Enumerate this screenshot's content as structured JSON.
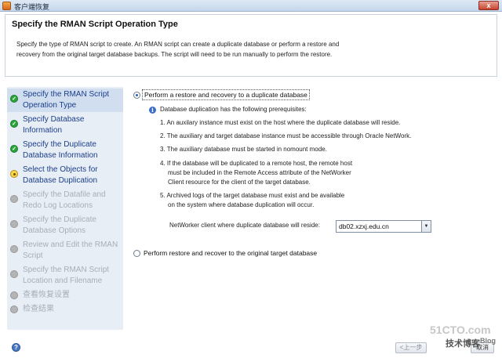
{
  "window": {
    "title": "客户端恢复",
    "close": "x"
  },
  "header": {
    "title": "Specify the RMAN Script Operation Type",
    "desc_line1": "Specify the type of RMAN script to create. An RMAN script can create a duplicate database or perform a restore and",
    "desc_line2": "recovery from the original target database backups.  The script will need to be run manually to perform the restore."
  },
  "steps": [
    {
      "line1": "Specify the RMAN Script",
      "line2": "Operation Type",
      "status": "done"
    },
    {
      "line1": "Specify Database",
      "line2": "Information",
      "status": "done"
    },
    {
      "line1": "Specify the Duplicate",
      "line2": "Database Information",
      "status": "done"
    },
    {
      "line1": "Select the Objects for",
      "line2": "Database Duplication",
      "status": "current"
    },
    {
      "line1": "Specify the Datafile and",
      "line2": "Redo Log Locations",
      "status": "pending"
    },
    {
      "line1": "Specify the Duplicate",
      "line2": "Database Options",
      "status": "pending"
    },
    {
      "line1": "Review and Edit the RMAN",
      "line2": "Script",
      "status": "pending"
    },
    {
      "line1": "Specify the RMAN Script",
      "line2": "Location and Filename",
      "status": "pending"
    },
    {
      "line1": "查看恢复设置",
      "status": "pending"
    },
    {
      "line1": "检查结果",
      "status": "pending"
    }
  ],
  "options": {
    "duplicate_label": "Perform a restore and recovery to a duplicate database",
    "original_label": "Perform restore and recover to the original target database"
  },
  "info": {
    "heading": "Database duplication has the following prerequisites:",
    "items": [
      {
        "lines": [
          "1. An auxilary instance must exist on the host where the duplicate database will reside."
        ]
      },
      {
        "lines": [
          "2. The auxiliary and target database instance must be accessible through Oracle NetWork."
        ]
      },
      {
        "lines": [
          "3. The auxiliary database must be started in nomount mode."
        ]
      },
      {
        "lines": [
          "4. If the database will be duplicated to a remote host, the remote host",
          "must be included in the Remote Access attribute of the NetWorker",
          "Client resource for the client of the target database."
        ]
      },
      {
        "lines": [
          "5. Archived logs of the target database must exist and be available",
          "on the system where database duplication will occur."
        ]
      }
    ]
  },
  "networker": {
    "label": "NetWorker client where duplicate database will reside:",
    "value": "db02.xzxj.edu.cn"
  },
  "footer": {
    "back": "<上一步",
    "cancel": "取消",
    "help": "?"
  },
  "watermark": {
    "main": "51CTO.com",
    "sub": "技术博客",
    "blog": "Blog"
  },
  "colors": {
    "step_done": "#29a53a",
    "step_current": "#fbd64b",
    "step_pending": "#b5b5b5",
    "link_blue": "#1b3f8a"
  }
}
